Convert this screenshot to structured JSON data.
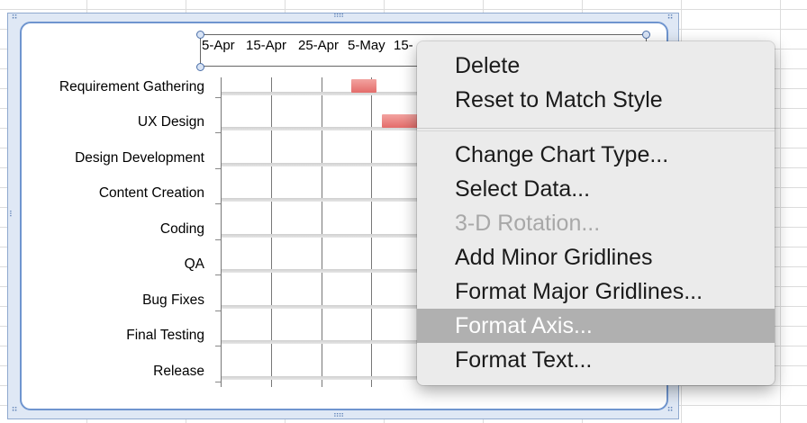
{
  "chart": {
    "x_ticks": [
      "5-Apr",
      "15-Apr",
      "25-Apr",
      "5-May",
      "15-"
    ],
    "tasks": [
      "Requirement Gathering",
      "UX Design",
      "Design Development",
      "Content Creation",
      "Coding",
      "QA",
      "Bug Fixes",
      "Final Testing",
      "Release"
    ],
    "bar_color": "#e46c6a",
    "frame_color": "#6f95cf"
  },
  "context_menu": {
    "items": [
      {
        "label": "Delete",
        "state": "enabled"
      },
      {
        "label": "Reset to Match Style",
        "state": "enabled"
      },
      {
        "label": "Change Chart Type...",
        "state": "enabled"
      },
      {
        "label": "Select Data...",
        "state": "enabled"
      },
      {
        "label": "3-D Rotation...",
        "state": "disabled"
      },
      {
        "label": "Add Minor Gridlines",
        "state": "enabled"
      },
      {
        "label": "Format Major Gridlines...",
        "state": "enabled"
      },
      {
        "label": "Format Axis...",
        "state": "highlighted"
      },
      {
        "label": "Format Text...",
        "state": "enabled"
      }
    ],
    "highlight_color": "#b0b0b0"
  }
}
